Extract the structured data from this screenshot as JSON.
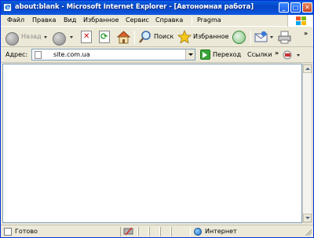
{
  "window": {
    "title": "about:blank - Microsoft Internet Explorer - [Автономная работа]"
  },
  "menu": {
    "items": [
      "Файл",
      "Правка",
      "Вид",
      "Избранное",
      "Сервис",
      "Справка",
      "Pragma"
    ]
  },
  "toolbar": {
    "back_label": "Назад",
    "search_label": "Поиск",
    "favorites_label": "Избранное"
  },
  "address": {
    "label": "Адрес:",
    "value": "site.com.ua",
    "go_label": "Переход",
    "links_label": "Ссылки"
  },
  "status": {
    "text": "Готово",
    "zone": "Интернет"
  },
  "colors": {
    "titlebar": "#0a5fe0",
    "chrome": "#ece9d8",
    "content": "#ffffff"
  }
}
